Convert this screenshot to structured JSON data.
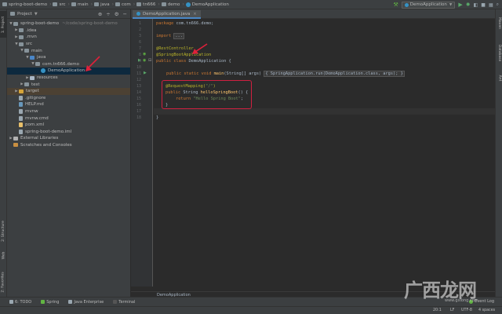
{
  "navbar": {
    "crumbs": [
      "spring-boot-demo",
      "src",
      "main",
      "java",
      "com",
      "tn666",
      "demo",
      "DemoApplication"
    ],
    "run_config": "DemoApplication"
  },
  "left_strip": {
    "project": "1: Project",
    "structure": "2: Structure",
    "web": "Web",
    "favorites": "2: Favorites"
  },
  "right_strip": {
    "maven": "Maven",
    "database": "Database",
    "ant": "Ant"
  },
  "project_panel": {
    "title": "Project",
    "tree": [
      {
        "label": "spring-boot-demo",
        "hint": "~/code/spring-boot-demo",
        "indent": 0,
        "arrow": "▼",
        "icon": "folder"
      },
      {
        "label": ".idea",
        "indent": 1,
        "arrow": "▶",
        "icon": "folder"
      },
      {
        "label": ".mvn",
        "indent": 1,
        "arrow": "▶",
        "icon": "folder"
      },
      {
        "label": "src",
        "indent": 1,
        "arrow": "▼",
        "icon": "folder"
      },
      {
        "label": "main",
        "indent": 2,
        "arrow": "▼",
        "icon": "folder"
      },
      {
        "label": "java",
        "indent": 3,
        "arrow": "▼",
        "icon": "src"
      },
      {
        "label": "com.tn666.demo",
        "indent": 4,
        "arrow": "▼",
        "icon": "pkg"
      },
      {
        "label": "DemoApplication",
        "indent": 5,
        "arrow": "",
        "icon": "cls",
        "selected": true
      },
      {
        "label": "resources",
        "indent": 3,
        "arrow": "▶",
        "icon": "res"
      },
      {
        "label": "test",
        "indent": 2,
        "arrow": "▶",
        "icon": "folder"
      },
      {
        "label": "target",
        "indent": 1,
        "arrow": "▶",
        "icon": "target",
        "target": true
      },
      {
        "label": ".gitignore",
        "indent": 1,
        "arrow": "",
        "icon": "file"
      },
      {
        "label": "HELP.md",
        "indent": 1,
        "arrow": "",
        "icon": "md"
      },
      {
        "label": "mvnw",
        "indent": 1,
        "arrow": "",
        "icon": "file"
      },
      {
        "label": "mvnw.cmd",
        "indent": 1,
        "arrow": "",
        "icon": "file"
      },
      {
        "label": "pom.xml",
        "indent": 1,
        "arrow": "",
        "icon": "xml"
      },
      {
        "label": "spring-boot-demo.iml",
        "indent": 1,
        "arrow": "",
        "icon": "file"
      },
      {
        "label": "External Libraries",
        "indent": 0,
        "arrow": "▶",
        "icon": "lib"
      },
      {
        "label": "Scratches and Consoles",
        "indent": 0,
        "arrow": "",
        "icon": "scr"
      }
    ]
  },
  "editor": {
    "tab": "DemoApplication.java",
    "line_numbers": [
      "1",
      "2",
      "3",
      "6",
      "7",
      "8",
      "9",
      "10",
      "11",
      "12",
      "13",
      "14",
      "15",
      "16",
      "17",
      "18",
      "19",
      "20",
      "21",
      "22"
    ],
    "code": {
      "l1_kw": "package ",
      "l1_tx": "com.tn666.demo;",
      "l3_kw": "import ",
      "l3_fold": "...",
      "l7_an": "@RestController",
      "l8_an": "@SpringBootApplication",
      "l9_kw": "public class ",
      "l9_tx": "DemoApplication {",
      "l11_kw": "public static void ",
      "l11_fn": "main",
      "l11_tx1": "(String[] args) ",
      "l11_fold": "{ SpringApplication.run(DemoApplication.class, args); }",
      "l15_an": "@RequestMapping(",
      "l15_st": "\"/\"",
      "l15_tx": ")",
      "l16_kw": "public ",
      "l16_tx1": "String ",
      "l16_fn": "helloSpringBoot",
      "l16_tx2": "() {",
      "l17_kw": "return ",
      "l17_st": "\"Hello Spring Boot\"",
      "l17_tx": ";",
      "l18_tx": "}",
      "l21_tx": "}"
    },
    "breadcrumb": "DemoApplication"
  },
  "bottom_tools": [
    "6: TODO",
    "Spring",
    "Java Enterprise",
    "Terminal"
  ],
  "event_log": "Event Log",
  "status": {
    "position": "20:1",
    "line_sep": "LF",
    "encoding": "UTF-8",
    "indent": "4 spaces"
  },
  "watermark": {
    "main": "广西龙网",
    "sub": "www.gxlong.com"
  },
  "colors": {
    "accent": "#4a88c7",
    "annotation_box": "#d02040",
    "keyword": "#cc7832",
    "annotation": "#bbb529",
    "string": "#6a8759"
  }
}
